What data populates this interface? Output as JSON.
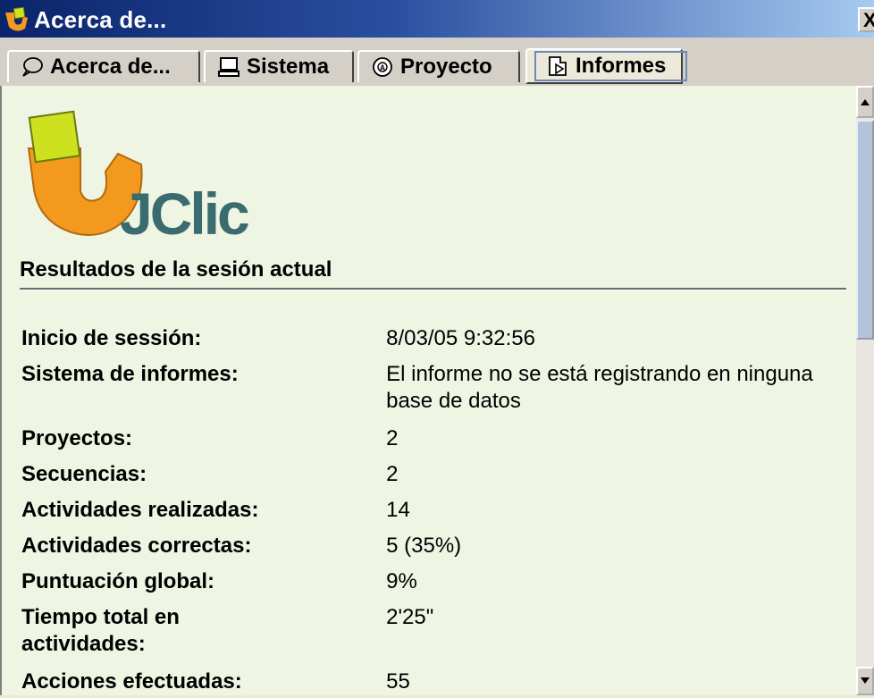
{
  "window": {
    "title": "Acerca de...",
    "close_glyph": "X"
  },
  "tabs": [
    {
      "label": "Acerca de...",
      "icon": "speech-bubble-icon",
      "active": false
    },
    {
      "label": "Sistema",
      "icon": "computer-icon",
      "active": false
    },
    {
      "label": "Proyecto",
      "icon": "project-disc-icon",
      "active": false
    },
    {
      "label": "Informes",
      "icon": "report-document-icon",
      "active": true
    }
  ],
  "logo": {
    "text": "JClic",
    "colors": {
      "orange": "#f39a1e",
      "green": "#cde11f",
      "text": "#3a6b6e"
    }
  },
  "report": {
    "heading": "Resultados de la sesión actual",
    "rows": [
      {
        "label": "Inicio de sessión:",
        "value": "8/03/05 9:32:56"
      },
      {
        "label": "Sistema de informes:",
        "value": "El informe no se está registrando en ninguna base de datos"
      },
      {
        "label": "Proyectos:",
        "value": "2"
      },
      {
        "label": "Secuencias:",
        "value": "2"
      },
      {
        "label": "Actividades realizadas:",
        "value": "14"
      },
      {
        "label": "Actividades correctas:",
        "value": "5 (35%)"
      },
      {
        "label": "Puntuación global:",
        "value": "9%"
      },
      {
        "label": "Tiempo total en actividades:",
        "value": "2'25\""
      },
      {
        "label": "Acciones efectuadas:",
        "value": "55"
      }
    ]
  },
  "colors": {
    "title_bar_start": "#0a246a",
    "title_bar_end": "#a6caf0",
    "content_background": "#eff5e3",
    "scroll_thumb": "#b5c3da"
  }
}
